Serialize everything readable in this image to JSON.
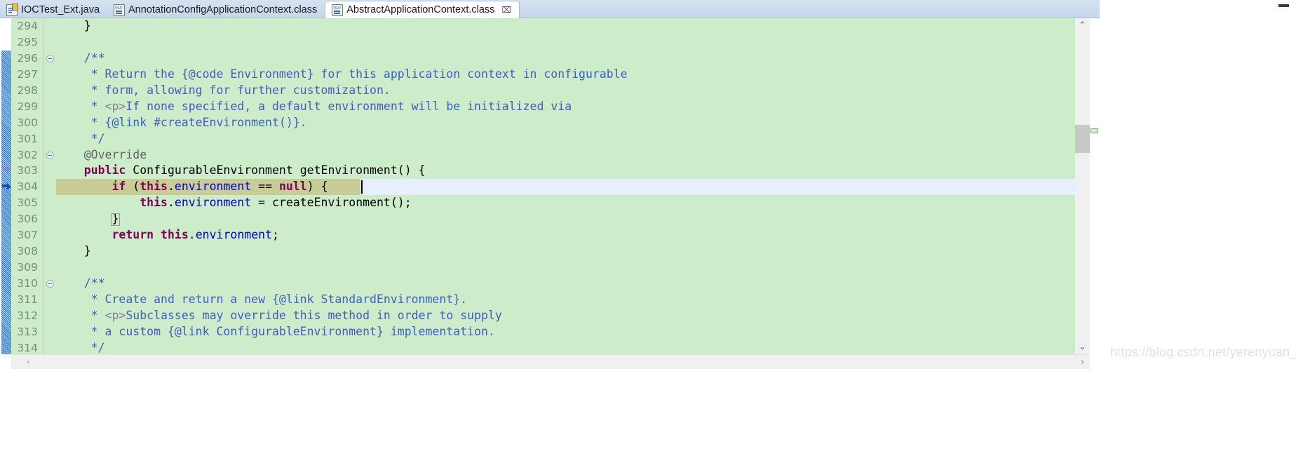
{
  "window": {
    "minimize_label": "minimize-window",
    "maximize_label": "maximize-window"
  },
  "tabs": [
    {
      "label": "IOCTest_Ext.java",
      "icon": "java-file-icon",
      "active": false,
      "closable": false
    },
    {
      "label": "AnnotationConfigApplicationContext.class",
      "icon": "class-file-icon",
      "active": false,
      "closable": false
    },
    {
      "label": "AbstractApplicationContext.class",
      "icon": "class-file-icon",
      "active": true,
      "closable": true,
      "close_glyph": "⌧"
    }
  ],
  "editor": {
    "language": "java",
    "background_color": "#cdecca",
    "current_line": 304,
    "colors": {
      "keyword": "#7f0055",
      "javadoc": "#3f5fbf",
      "javadoc_tag": "#7f7f9f",
      "field": "#0000c0",
      "annotation": "#646464",
      "line_number": "#7a8a7a",
      "current_line_highlight": "#e8eefb",
      "selection": "#c8cd97"
    },
    "lines": [
      {
        "n": "294",
        "fold": false,
        "marker": "",
        "segments": [
          {
            "t": "    }",
            "c": "plain"
          }
        ]
      },
      {
        "n": "295",
        "fold": false,
        "marker": "",
        "segments": [
          {
            "t": "",
            "c": "plain"
          }
        ]
      },
      {
        "n": "296",
        "fold": true,
        "marker": "",
        "segments": [
          {
            "t": "    /**",
            "c": "cmt"
          }
        ]
      },
      {
        "n": "297",
        "fold": false,
        "marker": "",
        "segments": [
          {
            "t": "     * Return the {@code Environment} for this application context in configurable",
            "c": "cmt"
          }
        ]
      },
      {
        "n": "298",
        "fold": false,
        "marker": "",
        "segments": [
          {
            "t": "     * form, allowing for further customization.",
            "c": "cmt"
          }
        ]
      },
      {
        "n": "299",
        "fold": false,
        "marker": "",
        "segments": [
          {
            "t": "     * ",
            "c": "cmt"
          },
          {
            "t": "<p>",
            "c": "tag"
          },
          {
            "t": "If none specified, a default environment will be initialized via",
            "c": "cmt"
          }
        ]
      },
      {
        "n": "300",
        "fold": false,
        "marker": "",
        "segments": [
          {
            "t": "     * {@link #createEnvironment()}.",
            "c": "cmt"
          }
        ]
      },
      {
        "n": "301",
        "fold": false,
        "marker": "",
        "segments": [
          {
            "t": "     */",
            "c": "cmt"
          }
        ]
      },
      {
        "n": "302",
        "fold": true,
        "marker": "",
        "segments": [
          {
            "t": "    @Override",
            "c": "anno"
          }
        ]
      },
      {
        "n": "303",
        "fold": false,
        "marker": "overview-triangle",
        "segments": [
          {
            "t": "    ",
            "c": "plain"
          },
          {
            "t": "public",
            "c": "kw"
          },
          {
            "t": " ConfigurableEnvironment getEnvironment() {",
            "c": "plain"
          }
        ]
      },
      {
        "n": "304",
        "fold": false,
        "marker": "debug-arrow",
        "current": true,
        "segments": [
          {
            "t": "        ",
            "c": "plain"
          },
          {
            "t": "if",
            "c": "kw"
          },
          {
            "t": " (",
            "c": "plain"
          },
          {
            "t": "this",
            "c": "kw"
          },
          {
            "t": ".",
            "c": "plain"
          },
          {
            "t": "environment",
            "c": "fld"
          },
          {
            "t": " == ",
            "c": "plain"
          },
          {
            "t": "null",
            "c": "kw"
          },
          {
            "t": ") {",
            "c": "plain"
          }
        ]
      },
      {
        "n": "305",
        "fold": false,
        "marker": "",
        "segments": [
          {
            "t": "            ",
            "c": "plain"
          },
          {
            "t": "this",
            "c": "kw"
          },
          {
            "t": ".",
            "c": "plain"
          },
          {
            "t": "environment",
            "c": "fld"
          },
          {
            "t": " = createEnvironment();",
            "c": "plain"
          }
        ]
      },
      {
        "n": "306",
        "fold": false,
        "marker": "",
        "bracket_match": true,
        "segments": [
          {
            "t": "        }",
            "c": "plain"
          }
        ]
      },
      {
        "n": "307",
        "fold": false,
        "marker": "",
        "segments": [
          {
            "t": "        ",
            "c": "plain"
          },
          {
            "t": "return",
            "c": "kw"
          },
          {
            "t": " ",
            "c": "plain"
          },
          {
            "t": "this",
            "c": "kw"
          },
          {
            "t": ".",
            "c": "plain"
          },
          {
            "t": "environment",
            "c": "fld"
          },
          {
            "t": ";",
            "c": "plain"
          }
        ]
      },
      {
        "n": "308",
        "fold": false,
        "marker": "",
        "segments": [
          {
            "t": "    }",
            "c": "plain"
          }
        ]
      },
      {
        "n": "309",
        "fold": false,
        "marker": "",
        "segments": [
          {
            "t": "",
            "c": "plain"
          }
        ]
      },
      {
        "n": "310",
        "fold": true,
        "marker": "",
        "segments": [
          {
            "t": "    /**",
            "c": "cmt"
          }
        ]
      },
      {
        "n": "311",
        "fold": false,
        "marker": "",
        "segments": [
          {
            "t": "     * Create and return a new {@link StandardEnvironment}.",
            "c": "cmt"
          }
        ]
      },
      {
        "n": "312",
        "fold": false,
        "marker": "",
        "segments": [
          {
            "t": "     * ",
            "c": "cmt"
          },
          {
            "t": "<p>",
            "c": "tag"
          },
          {
            "t": "Subclasses may override this method in order to supply",
            "c": "cmt"
          }
        ]
      },
      {
        "n": "313",
        "fold": false,
        "marker": "",
        "segments": [
          {
            "t": "     * a custom {@link ConfigurableEnvironment} implementation.",
            "c": "cmt"
          }
        ]
      },
      {
        "n": "314",
        "fold": false,
        "marker": "",
        "segments": [
          {
            "t": "     */",
            "c": "cmt"
          }
        ]
      }
    ]
  },
  "scrollbars": {
    "vertical": {
      "up_glyph": "⌃",
      "down_glyph": "⌄"
    },
    "horizontal": {
      "left_glyph": "‹",
      "right_glyph": "›"
    }
  },
  "watermark": "https://blog.csdn.net/yerenyuan_pku"
}
